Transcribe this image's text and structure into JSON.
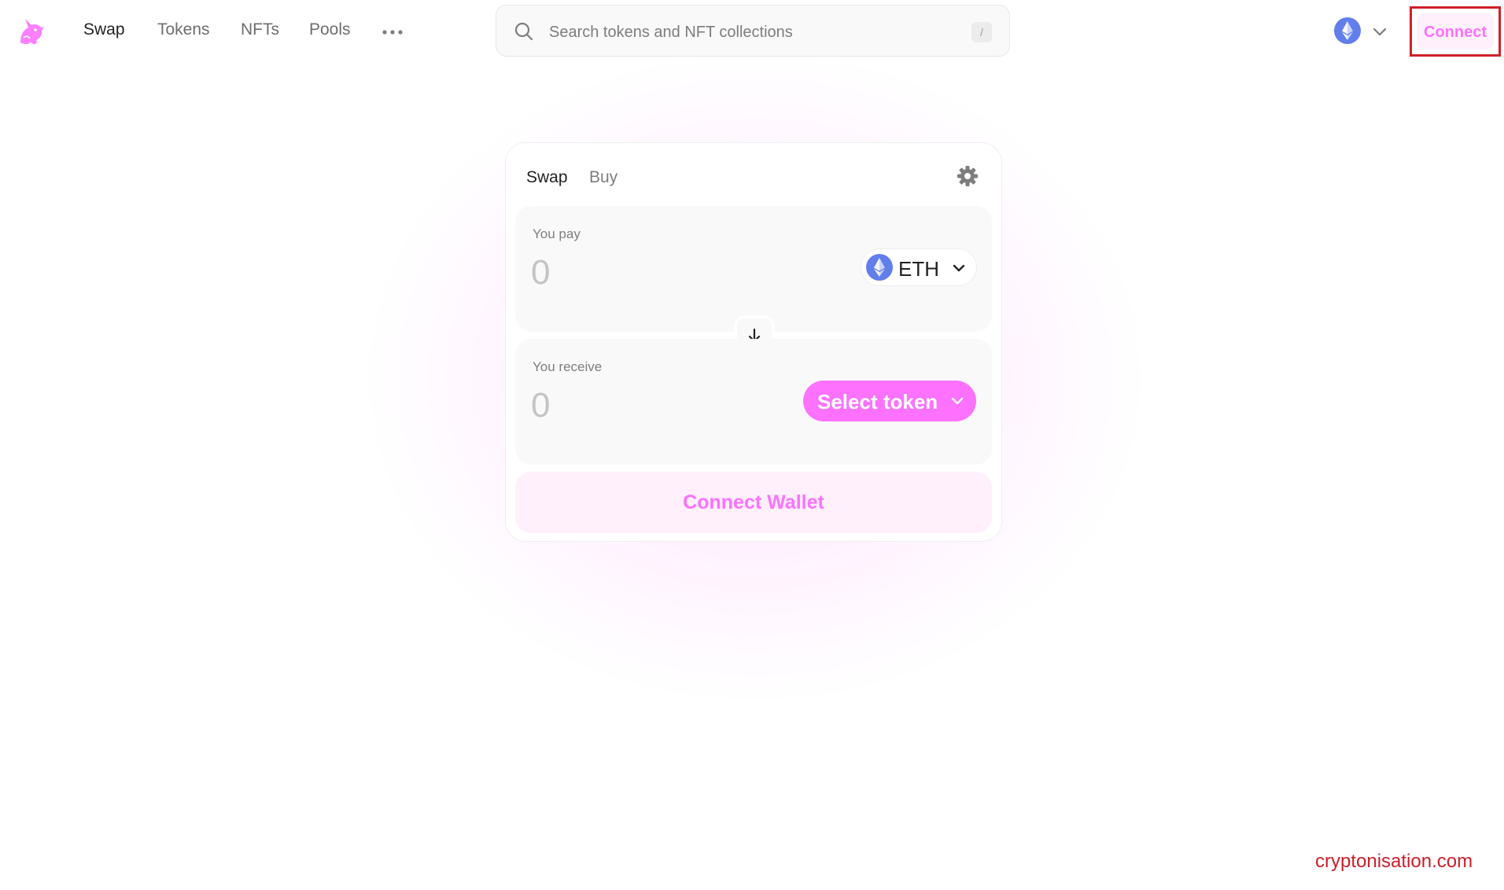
{
  "nav": {
    "logo_icon": "uniswap-unicorn-icon",
    "links": [
      {
        "label": "Swap",
        "active": true
      },
      {
        "label": "Tokens",
        "active": false
      },
      {
        "label": "NFTs",
        "active": false
      },
      {
        "label": "Pools",
        "active": false
      }
    ],
    "more_icon": "more-dots-icon",
    "search": {
      "placeholder": "Search tokens and NFT collections",
      "value": "",
      "shortcut": "/"
    },
    "network": {
      "icon": "ethereum-icon",
      "chevron_icon": "chevron-down-icon"
    },
    "connect_label": "Connect"
  },
  "swap_card": {
    "tabs": [
      {
        "label": "Swap",
        "active": true
      },
      {
        "label": "Buy",
        "active": false
      }
    ],
    "settings_icon": "gear-icon",
    "pay": {
      "label": "You pay",
      "amount_placeholder": "0",
      "amount_value": "",
      "token": {
        "symbol": "ETH",
        "icon": "ethereum-icon"
      }
    },
    "switch_icon": "arrow-down-icon",
    "receive": {
      "label": "You receive",
      "amount_placeholder": "0",
      "amount_value": "",
      "select_label": "Select token"
    },
    "connect_wallet_label": "Connect Wallet"
  },
  "watermark": "cryptonisation.com",
  "colors": {
    "accent": "#fc72ff",
    "accent_soft": "#fff0fc",
    "ethereum": "#627eea",
    "highlight_box": "#d21f2a",
    "watermark": "#c8202b"
  }
}
